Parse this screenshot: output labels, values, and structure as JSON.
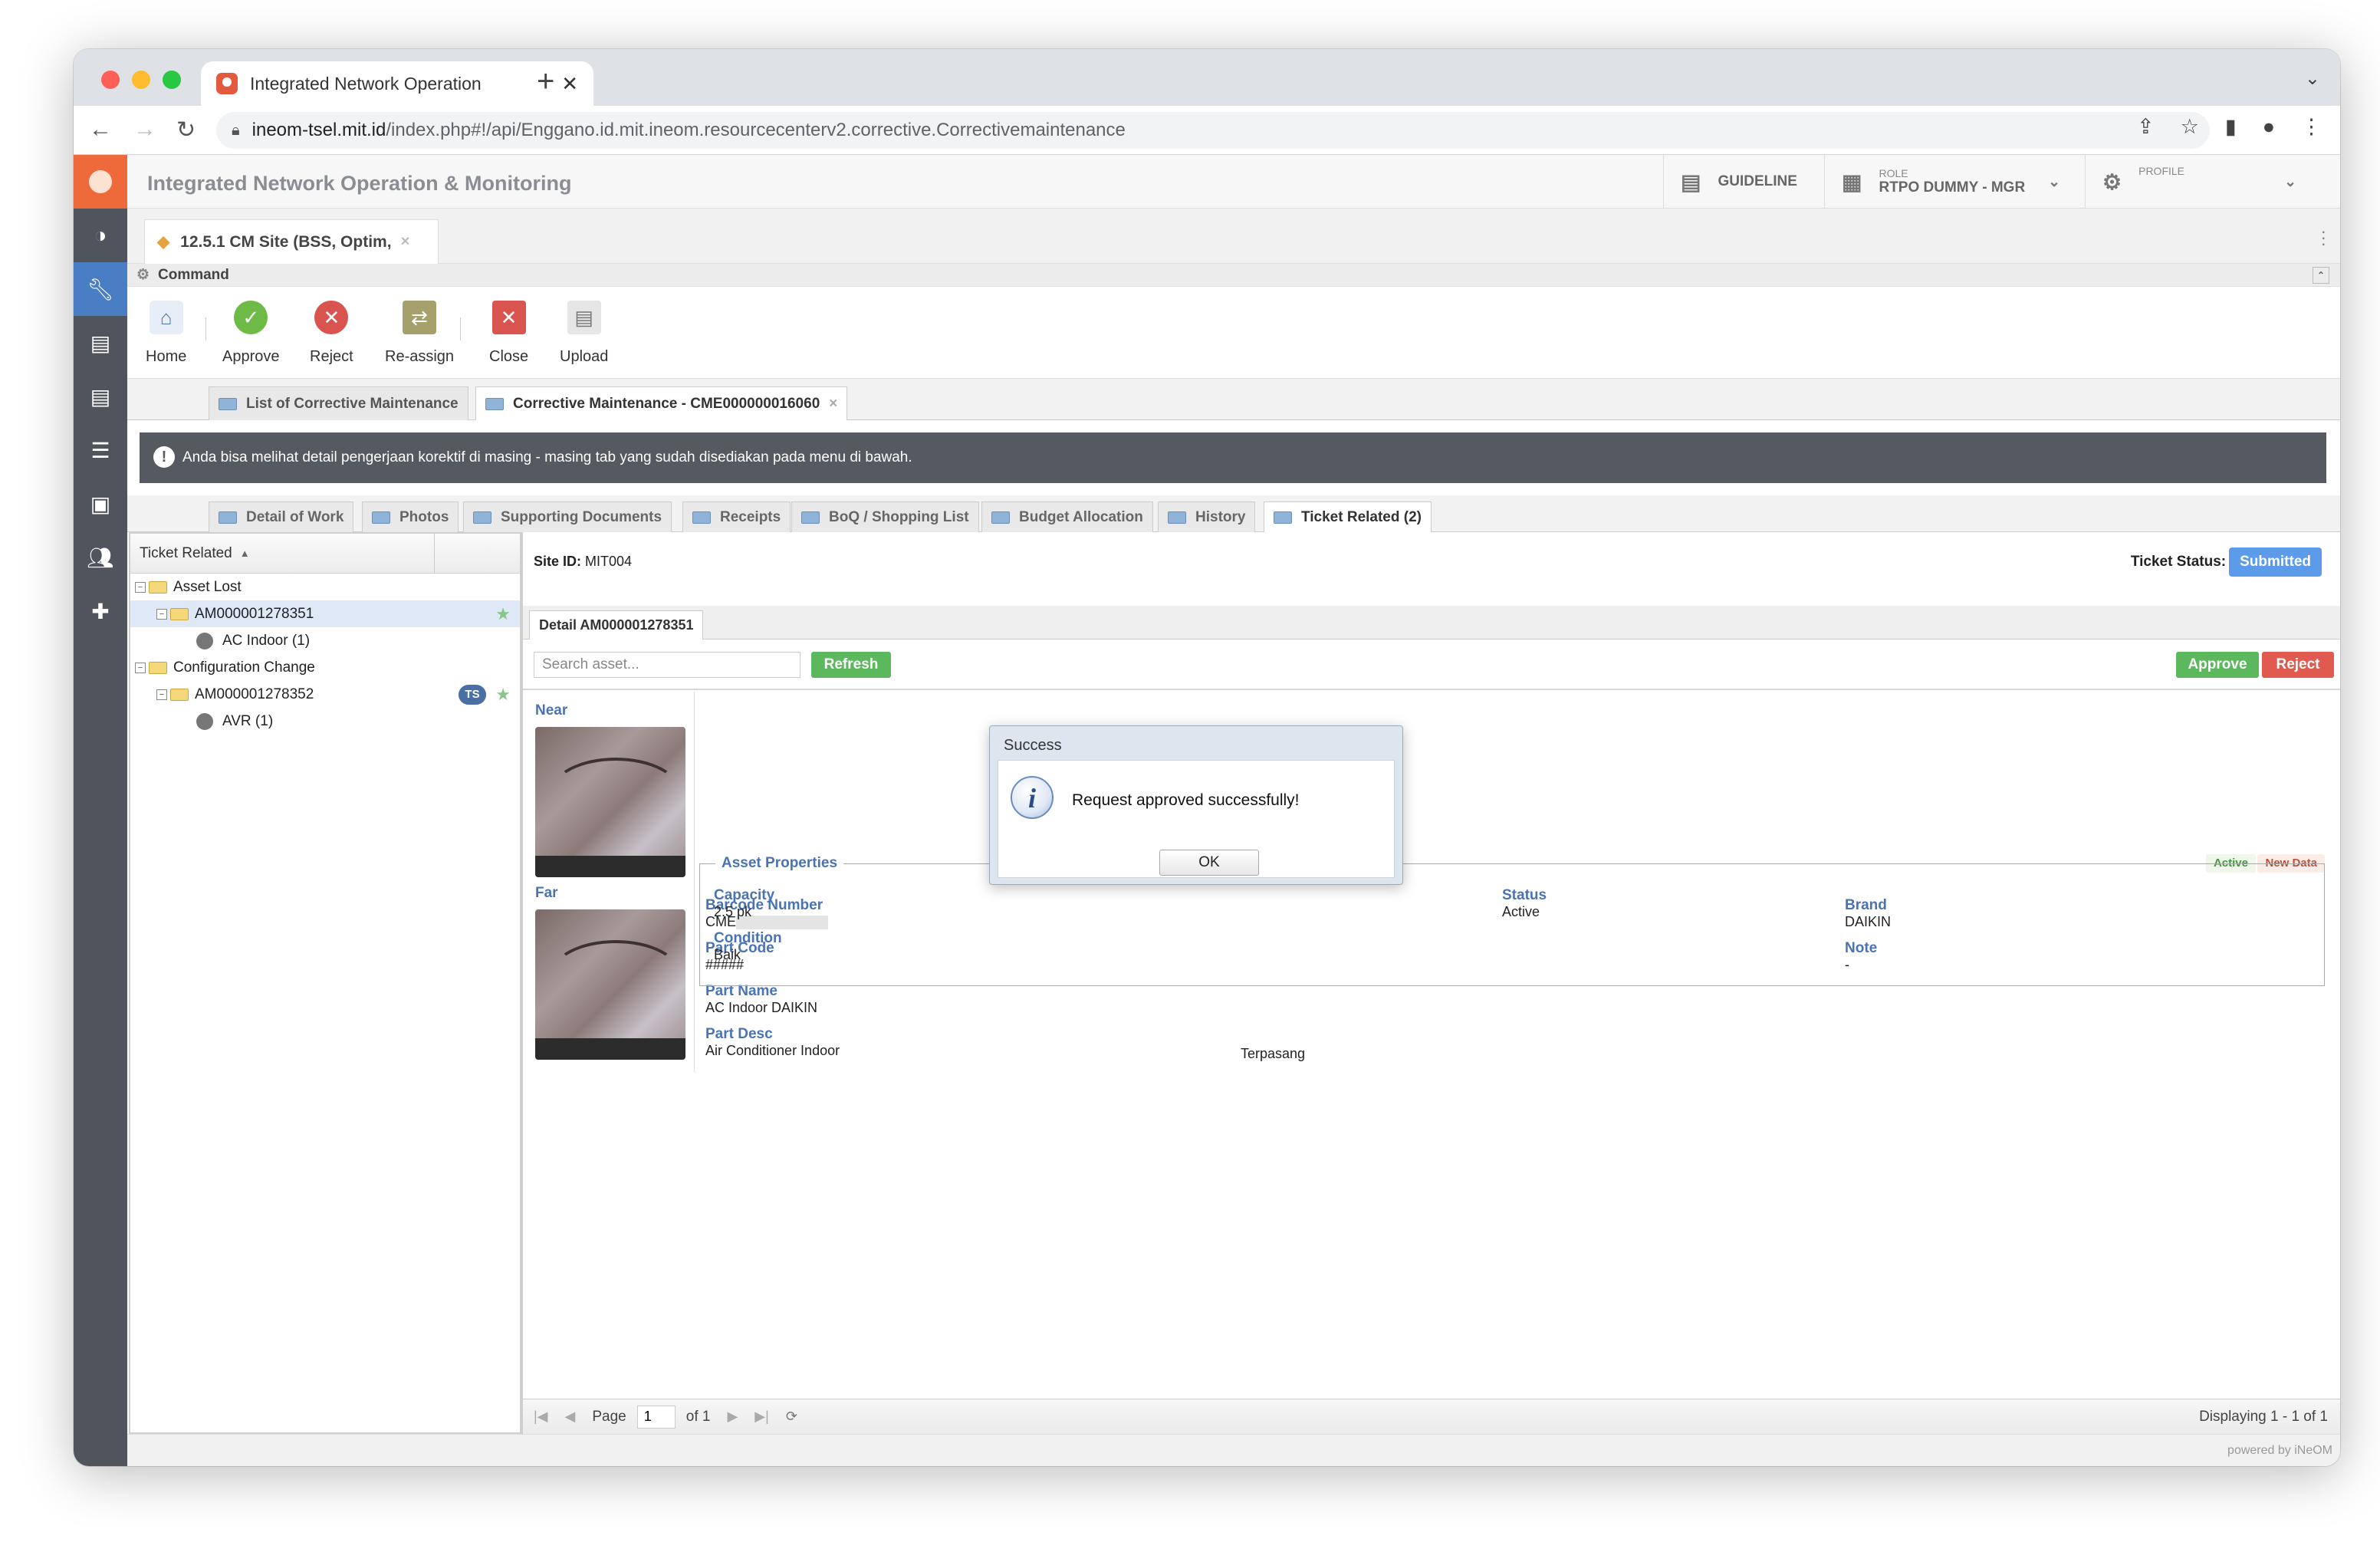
{
  "browser": {
    "tab_title": "Integrated Network Operation",
    "new_tab": "+",
    "url_host": "ineom-tsel.mit.id",
    "url_path": "/index.php#!/api/Enggano.id.mit.ineom.resourcecenterv2.corrective.Correctivemaintenance"
  },
  "app": {
    "title": "Integrated Network Operation & Monitoring",
    "guideline": "GUIDELINE",
    "role_label": "ROLE",
    "role_value": "RTPO DUMMY - MGR",
    "profile_label": "PROFILE",
    "doc_tab": "12.5.1 CM Site (BSS, Optim,",
    "command_title": "Command",
    "footer": "powered by iNeOM"
  },
  "toolbar": {
    "buttons": [
      "Home",
      "Approve",
      "Reject",
      "Re-assign",
      "Close",
      "Upload"
    ]
  },
  "work_tabs": [
    "List of Corrective Maintenance",
    "Corrective Maintenance - CME000000016060"
  ],
  "banner": "Anda bisa melihat detail pengerjaan korektif di masing - masing tab yang sudah disediakan pada menu di bawah.",
  "sub_tabs": [
    "Detail of Work",
    "Photos",
    "Supporting Documents",
    "Receipts",
    "BoQ / Shopping List",
    "Budget Allocation",
    "History",
    "Ticket Related (2)"
  ],
  "tree": {
    "header": "Ticket Related",
    "items": [
      {
        "label": "Asset Lost"
      },
      {
        "label": "AM000001278351"
      },
      {
        "label": "AC Indoor (1)"
      },
      {
        "label": "Configuration Change"
      },
      {
        "label": "AM000001278352",
        "badge": "TS"
      },
      {
        "label": "AVR (1)"
      }
    ]
  },
  "detail": {
    "site_label": "Site ID:",
    "site_value": "MIT004",
    "ticket_status_label": "Ticket Status:",
    "ticket_status": "Submitted",
    "detail_tab": "Detail AM000001278351",
    "search_placeholder": "Search asset...",
    "refresh": "Refresh",
    "approve": "Approve",
    "reject": "Reject",
    "near": "Near",
    "far": "Far",
    "badge_active": "Active",
    "badge_new": "New Data",
    "fields": {
      "barcode_label": "Barcode Number",
      "barcode_value": "CME",
      "partcode_label": "Part Code",
      "partcode_value": "#####",
      "partname_label": "Part Name",
      "partname_value": "AC Indoor DAIKIN",
      "partdesc_label": "Part Desc",
      "partdesc_value": "Air Conditioner Indoor",
      "status_pemasangan_value": "Terpasang",
      "brand_label": "Brand",
      "brand_value": "DAIKIN",
      "note_label": "Note",
      "note_value": "-"
    },
    "props": {
      "legend": "Asset Properties",
      "capacity_label": "Capacity",
      "capacity_value": "2.5 pk",
      "condition_label": "Condition",
      "condition_value": "Baik",
      "status_label": "Status",
      "status_value": "Active"
    },
    "pager": {
      "page": "Page",
      "page_value": "1",
      "of": "of 1",
      "displaying": "Displaying 1 - 1 of 1"
    }
  },
  "modal": {
    "title": "Success",
    "message": "Request approved successfully!",
    "ok": "OK"
  }
}
